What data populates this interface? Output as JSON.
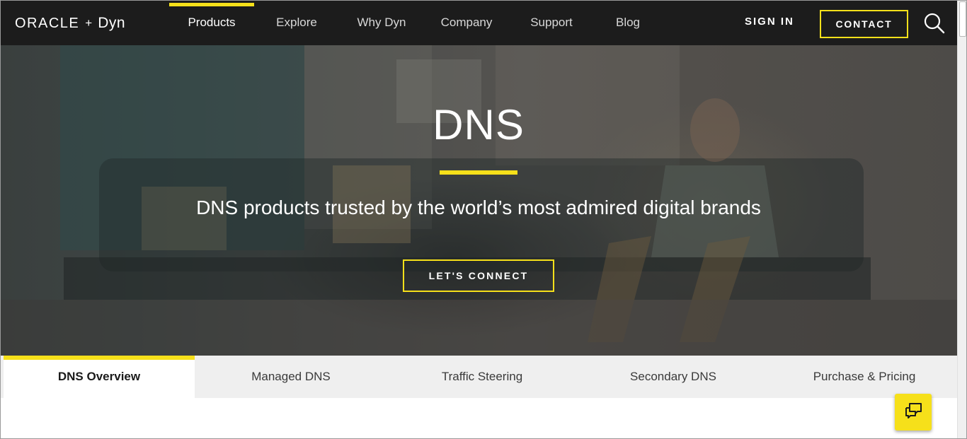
{
  "brand": {
    "oracle": "ORACLE",
    "plus": "+",
    "dyn": "Dyn"
  },
  "nav": {
    "items": [
      {
        "label": "Products",
        "active": true
      },
      {
        "label": "Explore",
        "active": false
      },
      {
        "label": "Why Dyn",
        "active": false
      },
      {
        "label": "Company",
        "active": false
      },
      {
        "label": "Support",
        "active": false
      },
      {
        "label": "Blog",
        "active": false
      }
    ],
    "sign_in": "SIGN IN",
    "contact": "CONTACT",
    "search_icon": "search-icon"
  },
  "hero": {
    "title": "DNS",
    "subtitle": "DNS products trusted by the world’s most admired digital brands",
    "cta": "LET'S CONNECT"
  },
  "subtabs": [
    {
      "label": "DNS Overview",
      "active": true
    },
    {
      "label": "Managed DNS",
      "active": false
    },
    {
      "label": "Traffic Steering",
      "active": false
    },
    {
      "label": "Secondary DNS",
      "active": false
    },
    {
      "label": "Purchase & Pricing",
      "active": false
    }
  ],
  "chat": {
    "icon": "chat-icon"
  },
  "colors": {
    "accent": "#f6e01a",
    "nav_bg": "#1c1c1c",
    "tab_bar_bg": "#efefef"
  }
}
